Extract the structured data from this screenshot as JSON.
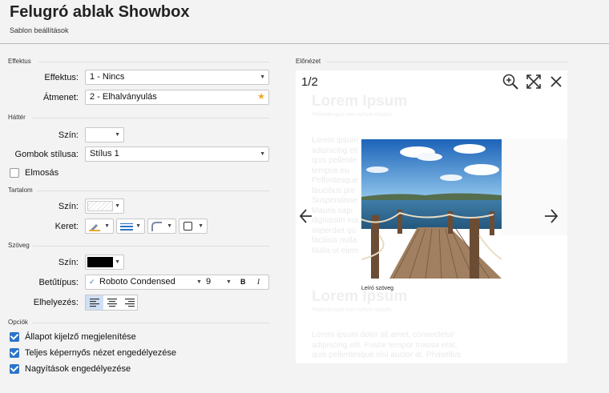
{
  "header": {
    "title": "Felugró ablak Showbox",
    "subtitle": "Sablon beállítások"
  },
  "effects": {
    "section": "Effektus",
    "effect_label": "Effektus:",
    "effect_value": "1 - Nincs",
    "transition_label": "Átmenet:",
    "transition_value": "2 - Elhalványulás"
  },
  "background": {
    "section": "Háttér",
    "color_label": "Szín:",
    "button_style_label": "Gombok stílusa:",
    "button_style_value": "Stílus 1",
    "blur_label": "Elmosás",
    "blur_checked": false
  },
  "content": {
    "section": "Tartalom",
    "color_label": "Szín:",
    "border_label": "Keret:"
  },
  "text": {
    "section": "Szöveg",
    "color_label": "Szín:",
    "color_value": "#000000",
    "font_label": "Betűtípus:",
    "font_value": "Roboto Condensed",
    "font_size": "9",
    "bold": "B",
    "italic": "I",
    "align_label": "Elhelyezés:"
  },
  "options": {
    "section": "Opciók",
    "items": [
      {
        "label": "Állapot kijelző megjelenítése",
        "checked": true
      },
      {
        "label": "Teljes képernyős nézet engedélyezése",
        "checked": true
      },
      {
        "label": "Nagyítások engedélyezése",
        "checked": true
      }
    ]
  },
  "preview": {
    "section": "Előnézet",
    "counter": "1/2",
    "caption": "Leíró szöveg",
    "lorem_heading": "Lorem Ipsum",
    "lorem_sub": "Pellentesque non rutrum mauris.",
    "lorem_lines": [
      "Lorem ipsum",
      "adipiscing eli",
      "quis pellente",
      "tempus eu",
      "Pellentesque",
      "faucibus pre",
      "Suspendisse",
      "Mauris sapi",
      "dignissim ma",
      "imperdiet qu",
      "facilisis nulla",
      "Nulla ut elem"
    ],
    "lorem_lines2": [
      "Lorem ipsum dolor sit amet, consectetur",
      "adipiscing elit. Fusce tempor massa erat,",
      "quis pellentesque nisi auctor at. Phasellus"
    ],
    "icons": [
      "zoom-in-icon",
      "fullscreen-icon",
      "close-icon",
      "arrow-left-icon",
      "arrow-right-icon"
    ]
  }
}
